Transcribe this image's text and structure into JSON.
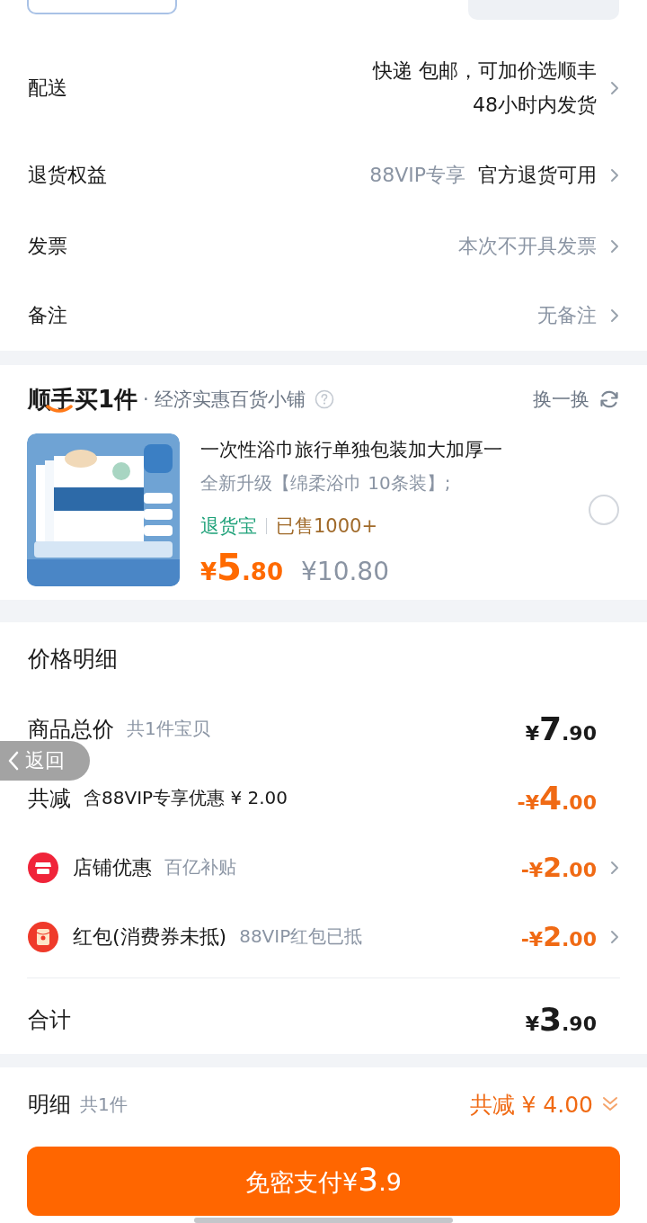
{
  "info_rows": [
    {
      "label": "配送",
      "values": [
        "快递 包邮，可加价选顺丰",
        "48小时内发货"
      ]
    },
    {
      "label": "退货权益",
      "values": [
        "88VIP专享",
        "官方退货可用"
      ]
    },
    {
      "label": "发票",
      "values": [
        "本次不开具发票"
      ]
    },
    {
      "label": "备注",
      "values": [
        "无备注"
      ]
    }
  ],
  "addon": {
    "logo": "顺手买1件",
    "shop": "· 经济实惠百货小铺",
    "switch_label": "换一换",
    "product": {
      "title": "一次性浴巾旅行单独包装加大加厚一",
      "spec": "全新升级【绵柔浴巾 10条装】;",
      "guarantee": "退货宝",
      "sold": "已售1000+",
      "price": "¥5.80",
      "original_price": "¥10.80",
      "selected": false
    }
  },
  "price_detail": {
    "title": "价格明细",
    "rows": [
      {
        "kind": "main",
        "label": "商品总价",
        "note": "共1件宝贝",
        "amount": "¥7.90",
        "arrow": false
      },
      {
        "kind": "main",
        "label": "共减",
        "note": "含88VIP专享优惠 ¥ 2.00",
        "amount": "-¥4.00",
        "arrow": false
      },
      {
        "kind": "sub",
        "label": "店铺优惠",
        "note": "百亿补贴",
        "amount": "-¥2.00",
        "arrow": true
      },
      {
        "kind": "sub",
        "label": "红包(消费券未抵)",
        "note": "88VIP红包已抵",
        "amount": "-¥2.00",
        "arrow": true
      }
    ],
    "total_label": "合计",
    "total_amount": "¥3.90"
  },
  "bottom_bar": {
    "label": "明细",
    "count": "共1件",
    "discount": "共减 ¥ 4.00",
    "expanded": false,
    "pay_button": "免密支付¥3.9"
  },
  "back_button": {
    "label": "返回"
  }
}
